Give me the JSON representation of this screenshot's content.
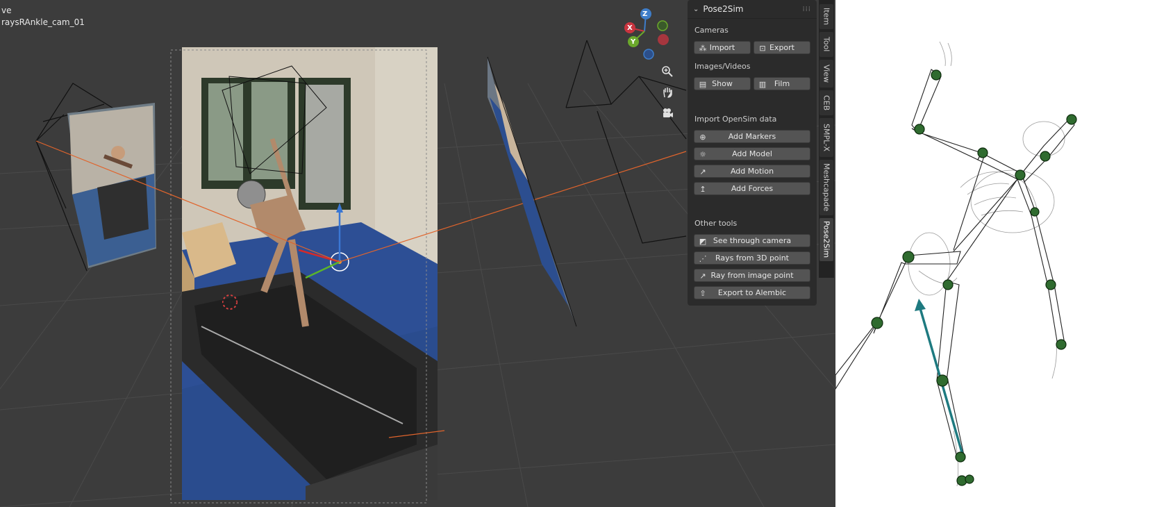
{
  "viewport": {
    "mode_label": "ve",
    "object_label": "raysRAnkle_cam_01"
  },
  "gizmo": {
    "z_label": "Z",
    "x_label": "X",
    "y_label": "Y",
    "colors": {
      "x": "#c9343f",
      "y": "#6ba92b",
      "z": "#3e7dc9"
    }
  },
  "nav_icons": [
    "zoom-icon",
    "hand-icon",
    "camera-icon"
  ],
  "panel": {
    "title": "Pose2Sim",
    "sections": {
      "cameras": "Cameras",
      "images": "Images/Videos",
      "opensim": "Import OpenSim data",
      "other": "Other tools"
    },
    "buttons": {
      "import": "Import",
      "export": "Export",
      "show": "Show",
      "film": "Film",
      "add_markers": "Add Markers",
      "add_model": "Add Model",
      "add_motion": "Add Motion",
      "add_forces": "Add Forces",
      "see_through": "See through camera",
      "rays_3d": "Rays from 3D point",
      "ray_image": "Ray from image point",
      "export_alembic": "Export to Alembic"
    }
  },
  "tabs": [
    "Item",
    "Tool",
    "View",
    "CEB",
    "SMPL-X",
    "Meshcapade",
    "Pose2Sim"
  ],
  "active_tab": "Pose2Sim",
  "colors": {
    "viewport_bg": "#3c3c3c",
    "panel_bg": "#2b2b2b",
    "button_bg": "#545454",
    "ray_color": "#e0642c",
    "marker_green": "#2f6b2f",
    "arrow_teal": "#1e7a80"
  }
}
